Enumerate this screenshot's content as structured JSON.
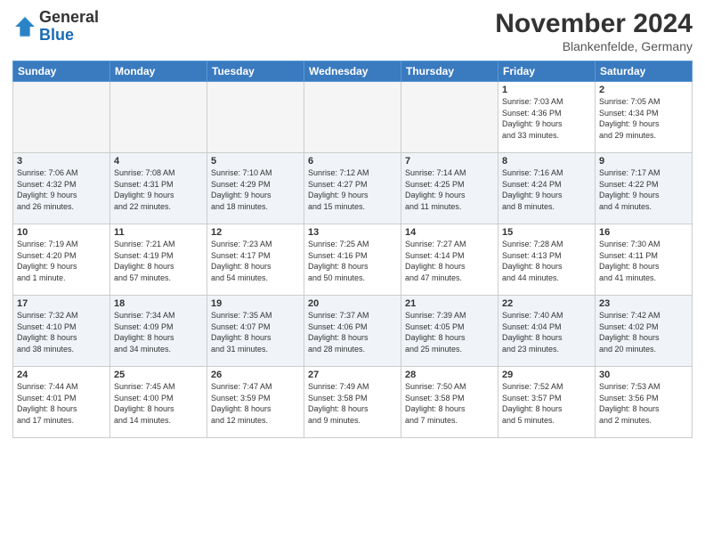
{
  "logo": {
    "general": "General",
    "blue": "Blue"
  },
  "header": {
    "month": "November 2024",
    "location": "Blankenfelde, Germany"
  },
  "days_of_week": [
    "Sunday",
    "Monday",
    "Tuesday",
    "Wednesday",
    "Thursday",
    "Friday",
    "Saturday"
  ],
  "weeks": [
    [
      {
        "day": "",
        "info": ""
      },
      {
        "day": "",
        "info": ""
      },
      {
        "day": "",
        "info": ""
      },
      {
        "day": "",
        "info": ""
      },
      {
        "day": "",
        "info": ""
      },
      {
        "day": "1",
        "info": "Sunrise: 7:03 AM\nSunset: 4:36 PM\nDaylight: 9 hours\nand 33 minutes."
      },
      {
        "day": "2",
        "info": "Sunrise: 7:05 AM\nSunset: 4:34 PM\nDaylight: 9 hours\nand 29 minutes."
      }
    ],
    [
      {
        "day": "3",
        "info": "Sunrise: 7:06 AM\nSunset: 4:32 PM\nDaylight: 9 hours\nand 26 minutes."
      },
      {
        "day": "4",
        "info": "Sunrise: 7:08 AM\nSunset: 4:31 PM\nDaylight: 9 hours\nand 22 minutes."
      },
      {
        "day": "5",
        "info": "Sunrise: 7:10 AM\nSunset: 4:29 PM\nDaylight: 9 hours\nand 18 minutes."
      },
      {
        "day": "6",
        "info": "Sunrise: 7:12 AM\nSunset: 4:27 PM\nDaylight: 9 hours\nand 15 minutes."
      },
      {
        "day": "7",
        "info": "Sunrise: 7:14 AM\nSunset: 4:25 PM\nDaylight: 9 hours\nand 11 minutes."
      },
      {
        "day": "8",
        "info": "Sunrise: 7:16 AM\nSunset: 4:24 PM\nDaylight: 9 hours\nand 8 minutes."
      },
      {
        "day": "9",
        "info": "Sunrise: 7:17 AM\nSunset: 4:22 PM\nDaylight: 9 hours\nand 4 minutes."
      }
    ],
    [
      {
        "day": "10",
        "info": "Sunrise: 7:19 AM\nSunset: 4:20 PM\nDaylight: 9 hours\nand 1 minute."
      },
      {
        "day": "11",
        "info": "Sunrise: 7:21 AM\nSunset: 4:19 PM\nDaylight: 8 hours\nand 57 minutes."
      },
      {
        "day": "12",
        "info": "Sunrise: 7:23 AM\nSunset: 4:17 PM\nDaylight: 8 hours\nand 54 minutes."
      },
      {
        "day": "13",
        "info": "Sunrise: 7:25 AM\nSunset: 4:16 PM\nDaylight: 8 hours\nand 50 minutes."
      },
      {
        "day": "14",
        "info": "Sunrise: 7:27 AM\nSunset: 4:14 PM\nDaylight: 8 hours\nand 47 minutes."
      },
      {
        "day": "15",
        "info": "Sunrise: 7:28 AM\nSunset: 4:13 PM\nDaylight: 8 hours\nand 44 minutes."
      },
      {
        "day": "16",
        "info": "Sunrise: 7:30 AM\nSunset: 4:11 PM\nDaylight: 8 hours\nand 41 minutes."
      }
    ],
    [
      {
        "day": "17",
        "info": "Sunrise: 7:32 AM\nSunset: 4:10 PM\nDaylight: 8 hours\nand 38 minutes."
      },
      {
        "day": "18",
        "info": "Sunrise: 7:34 AM\nSunset: 4:09 PM\nDaylight: 8 hours\nand 34 minutes."
      },
      {
        "day": "19",
        "info": "Sunrise: 7:35 AM\nSunset: 4:07 PM\nDaylight: 8 hours\nand 31 minutes."
      },
      {
        "day": "20",
        "info": "Sunrise: 7:37 AM\nSunset: 4:06 PM\nDaylight: 8 hours\nand 28 minutes."
      },
      {
        "day": "21",
        "info": "Sunrise: 7:39 AM\nSunset: 4:05 PM\nDaylight: 8 hours\nand 25 minutes."
      },
      {
        "day": "22",
        "info": "Sunrise: 7:40 AM\nSunset: 4:04 PM\nDaylight: 8 hours\nand 23 minutes."
      },
      {
        "day": "23",
        "info": "Sunrise: 7:42 AM\nSunset: 4:02 PM\nDaylight: 8 hours\nand 20 minutes."
      }
    ],
    [
      {
        "day": "24",
        "info": "Sunrise: 7:44 AM\nSunset: 4:01 PM\nDaylight: 8 hours\nand 17 minutes."
      },
      {
        "day": "25",
        "info": "Sunrise: 7:45 AM\nSunset: 4:00 PM\nDaylight: 8 hours\nand 14 minutes."
      },
      {
        "day": "26",
        "info": "Sunrise: 7:47 AM\nSunset: 3:59 PM\nDaylight: 8 hours\nand 12 minutes."
      },
      {
        "day": "27",
        "info": "Sunrise: 7:49 AM\nSunset: 3:58 PM\nDaylight: 8 hours\nand 9 minutes."
      },
      {
        "day": "28",
        "info": "Sunrise: 7:50 AM\nSunset: 3:58 PM\nDaylight: 8 hours\nand 7 minutes."
      },
      {
        "day": "29",
        "info": "Sunrise: 7:52 AM\nSunset: 3:57 PM\nDaylight: 8 hours\nand 5 minutes."
      },
      {
        "day": "30",
        "info": "Sunrise: 7:53 AM\nSunset: 3:56 PM\nDaylight: 8 hours\nand 2 minutes."
      }
    ]
  ]
}
